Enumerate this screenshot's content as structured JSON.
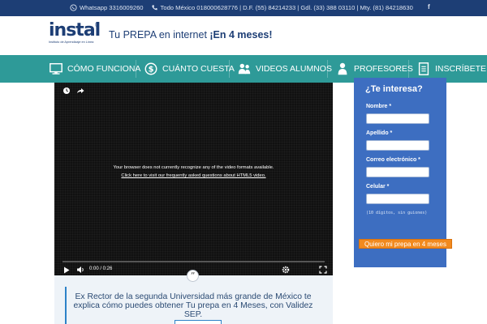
{
  "topbar": {
    "whatsapp": "Whatsapp 3316009260",
    "contacts": "Todo México 018000628776 | D.F. (55) 84214233 | Gdl. (33) 388 03110 | Mty. (81) 84218630",
    "facebook": "f"
  },
  "header": {
    "logo_word": "instal",
    "logo_sub": "Instituto de Aprendizaje en Línea",
    "logo_reg": "®",
    "tagline_part1": "Tu PREPA ",
    "tagline_part2": "en internet",
    "tagline_part3": " ¡En 4 meses!"
  },
  "nav": {
    "items": [
      {
        "label": "CÓMO FUNCIONA",
        "icon": "monitor-icon"
      },
      {
        "label": "CUÁNTO CUESTA",
        "icon": "dollar-icon"
      },
      {
        "label": "VIDEOS ALUMNOS",
        "icon": "users-icon"
      },
      {
        "label": "PROFESORES",
        "icon": "user-icon"
      },
      {
        "label": "INSCRÍBETE",
        "icon": "form-icon"
      }
    ]
  },
  "video": {
    "message_line1": "Your browser does not currently recognize any of the video formats available.",
    "message_line2": "Click here to visit our frequently asked questions about HTML5 video.",
    "time": "0:00 / 0:26"
  },
  "description": {
    "quote_mark": "”",
    "text": "Ex Rector de la segunda Universidad más grande de México te explica cómo puedes obtener Tu prepa en 4 Meses, con Validez SEP."
  },
  "form": {
    "title": "¿Te interesa?",
    "fields": [
      {
        "label": "Nombre *"
      },
      {
        "label": "Apellido *"
      },
      {
        "label": "Correo electrónico *"
      },
      {
        "label": "Celular *"
      }
    ],
    "hint": "(10 dígitos, sin guiones)",
    "submit": "Quiero mi prepa en 4 meses"
  },
  "colors": {
    "topbar": "#1d3e75",
    "nav": "#2e9a98",
    "form": "#3d6ec1",
    "submit": "#f28a1e"
  }
}
